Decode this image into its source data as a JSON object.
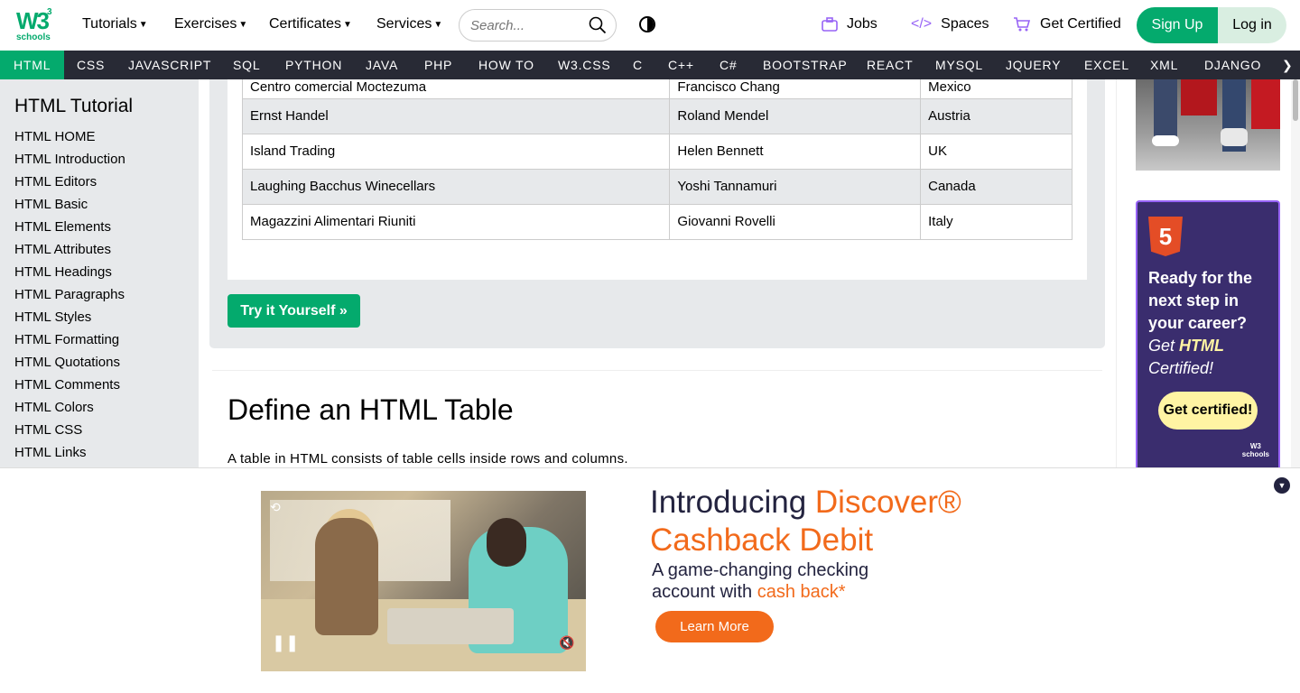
{
  "brand": {
    "w3": "W3",
    "sup": "3",
    "schools": "schools"
  },
  "topnav": {
    "tutorials": "Tutorials",
    "exercises": "Exercises",
    "certificates": "Certificates",
    "services": "Services",
    "search_placeholder": "Search...",
    "jobs": "Jobs",
    "spaces": "Spaces",
    "get_certified": "Get Certified",
    "sign_up": "Sign Up",
    "log_in": "Log in"
  },
  "subnav": [
    "HTML",
    "CSS",
    "JAVASCRIPT",
    "SQL",
    "PYTHON",
    "JAVA",
    "PHP",
    "HOW TO",
    "W3.CSS",
    "C",
    "C++",
    "C#",
    "BOOTSTRAP",
    "REACT",
    "MYSQL",
    "JQUERY",
    "EXCEL",
    "XML",
    "DJANGO"
  ],
  "subnav_more": "❯",
  "sidebar": {
    "title": "HTML Tutorial",
    "items": [
      "HTML HOME",
      "HTML Introduction",
      "HTML Editors",
      "HTML Basic",
      "HTML Elements",
      "HTML Attributes",
      "HTML Headings",
      "HTML Paragraphs",
      "HTML Styles",
      "HTML Formatting",
      "HTML Quotations",
      "HTML Comments",
      "HTML Colors",
      "HTML CSS",
      "HTML Links"
    ]
  },
  "table_rows": [
    [
      "Centro comercial Moctezuma",
      "Francisco Chang",
      "Mexico"
    ],
    [
      "Ernst Handel",
      "Roland Mendel",
      "Austria"
    ],
    [
      "Island Trading",
      "Helen Bennett",
      "UK"
    ],
    [
      "Laughing Bacchus Winecellars",
      "Yoshi Tannamuri",
      "Canada"
    ],
    [
      "Magazzini Alimentari Riuniti",
      "Giovanni Rovelli",
      "Italy"
    ]
  ],
  "try_button": "Try it Yourself »",
  "section": {
    "title": "Define an HTML Table",
    "text": "A table in HTML consists of table cells inside rows and columns."
  },
  "cert_ad": {
    "badge": "5",
    "line1": "Ready for the next step in your career?",
    "get": "Get ",
    "html": "HTML",
    "certified": "Certified!",
    "button": "Get certified!",
    "logo_top": "W3",
    "logo_bottom": "schools"
  },
  "bottom_ad": {
    "intro": "Introducing ",
    "discover": "Discover®",
    "cashback": "Cashback Debit",
    "sub1": "A game-changing checking",
    "sub2": "account with ",
    "sub2_orange": "cash back*",
    "button": "Learn More"
  },
  "colors": {
    "green": "#04AA6D",
    "dark": "#282A35",
    "purple": "#9763f6",
    "orange": "#f26a1b"
  }
}
